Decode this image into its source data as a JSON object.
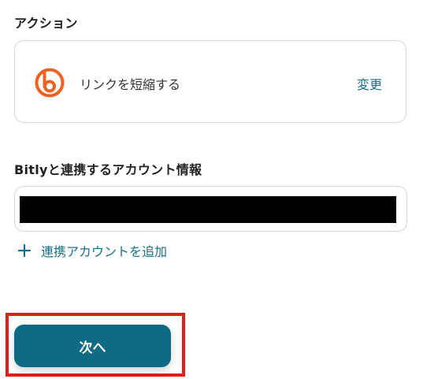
{
  "action_section": {
    "title": "アクション",
    "app_icon": "bitly-logo-icon",
    "action_label": "リンクを短縮する",
    "change_label": "変更"
  },
  "account_section": {
    "title": "Bitlyと連携するアカウント情報",
    "selected_account": "",
    "add_account_label": "連携アカウントを追加"
  },
  "footer": {
    "next_label": "次へ"
  },
  "colors": {
    "accent": "#1a6e8a",
    "primary_button": "#0f6b83",
    "bitly_orange": "#ee6123",
    "highlight": "#e01c1c"
  }
}
